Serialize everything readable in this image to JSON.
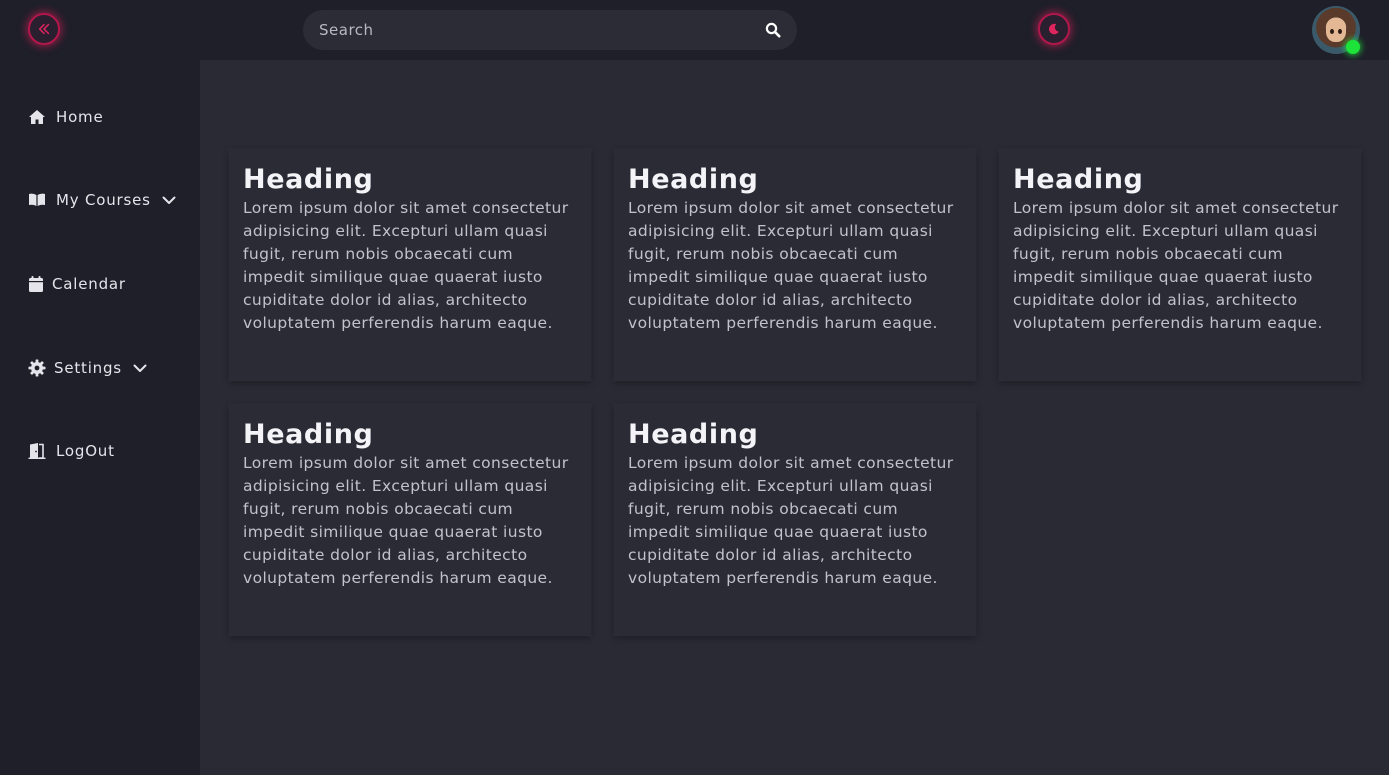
{
  "header": {
    "search_placeholder": "Search",
    "collapse_icon": "double-chevron-left-icon",
    "theme_icon": "moon-icon",
    "accent_color": "#b0174a",
    "status_color": "#1de23a"
  },
  "sidebar": {
    "items": [
      {
        "label": "Home",
        "icon": "home-icon"
      },
      {
        "label": "My Courses",
        "icon": "book-icon",
        "has_dropdown": true
      },
      {
        "label": "Calendar",
        "icon": "calendar-icon"
      },
      {
        "label": "Settings",
        "icon": "gear-icon",
        "has_dropdown": true
      },
      {
        "label": "LogOut",
        "icon": "logout-icon"
      }
    ]
  },
  "cards": [
    {
      "heading": "Heading",
      "body": "Lorem ipsum dolor sit amet consectetur adipisicing elit. Excepturi ullam quasi fugit, rerum nobis obcaecati cum impedit similique quae quaerat iusto cupiditate dolor id alias, architecto voluptatem perferendis harum eaque."
    },
    {
      "heading": "Heading",
      "body": "Lorem ipsum dolor sit amet consectetur adipisicing elit. Excepturi ullam quasi fugit, rerum nobis obcaecati cum impedit similique quae quaerat iusto cupiditate dolor id alias, architecto voluptatem perferendis harum eaque."
    },
    {
      "heading": "Heading",
      "body": "Lorem ipsum dolor sit amet consectetur adipisicing elit. Excepturi ullam quasi fugit, rerum nobis obcaecati cum impedit similique quae quaerat iusto cupiditate dolor id alias, architecto voluptatem perferendis harum eaque."
    },
    {
      "heading": "Heading",
      "body": "Lorem ipsum dolor sit amet consectetur adipisicing elit. Excepturi ullam quasi fugit, rerum nobis obcaecati cum impedit similique quae quaerat iusto cupiditate dolor id alias, architecto voluptatem perferendis harum eaque."
    },
    {
      "heading": "Heading",
      "body": "Lorem ipsum dolor sit amet consectetur adipisicing elit. Excepturi ullam quasi fugit, rerum nobis obcaecati cum impedit similique quae quaerat iusto cupiditate dolor id alias, architecto voluptatem perferendis harum eaque."
    }
  ]
}
